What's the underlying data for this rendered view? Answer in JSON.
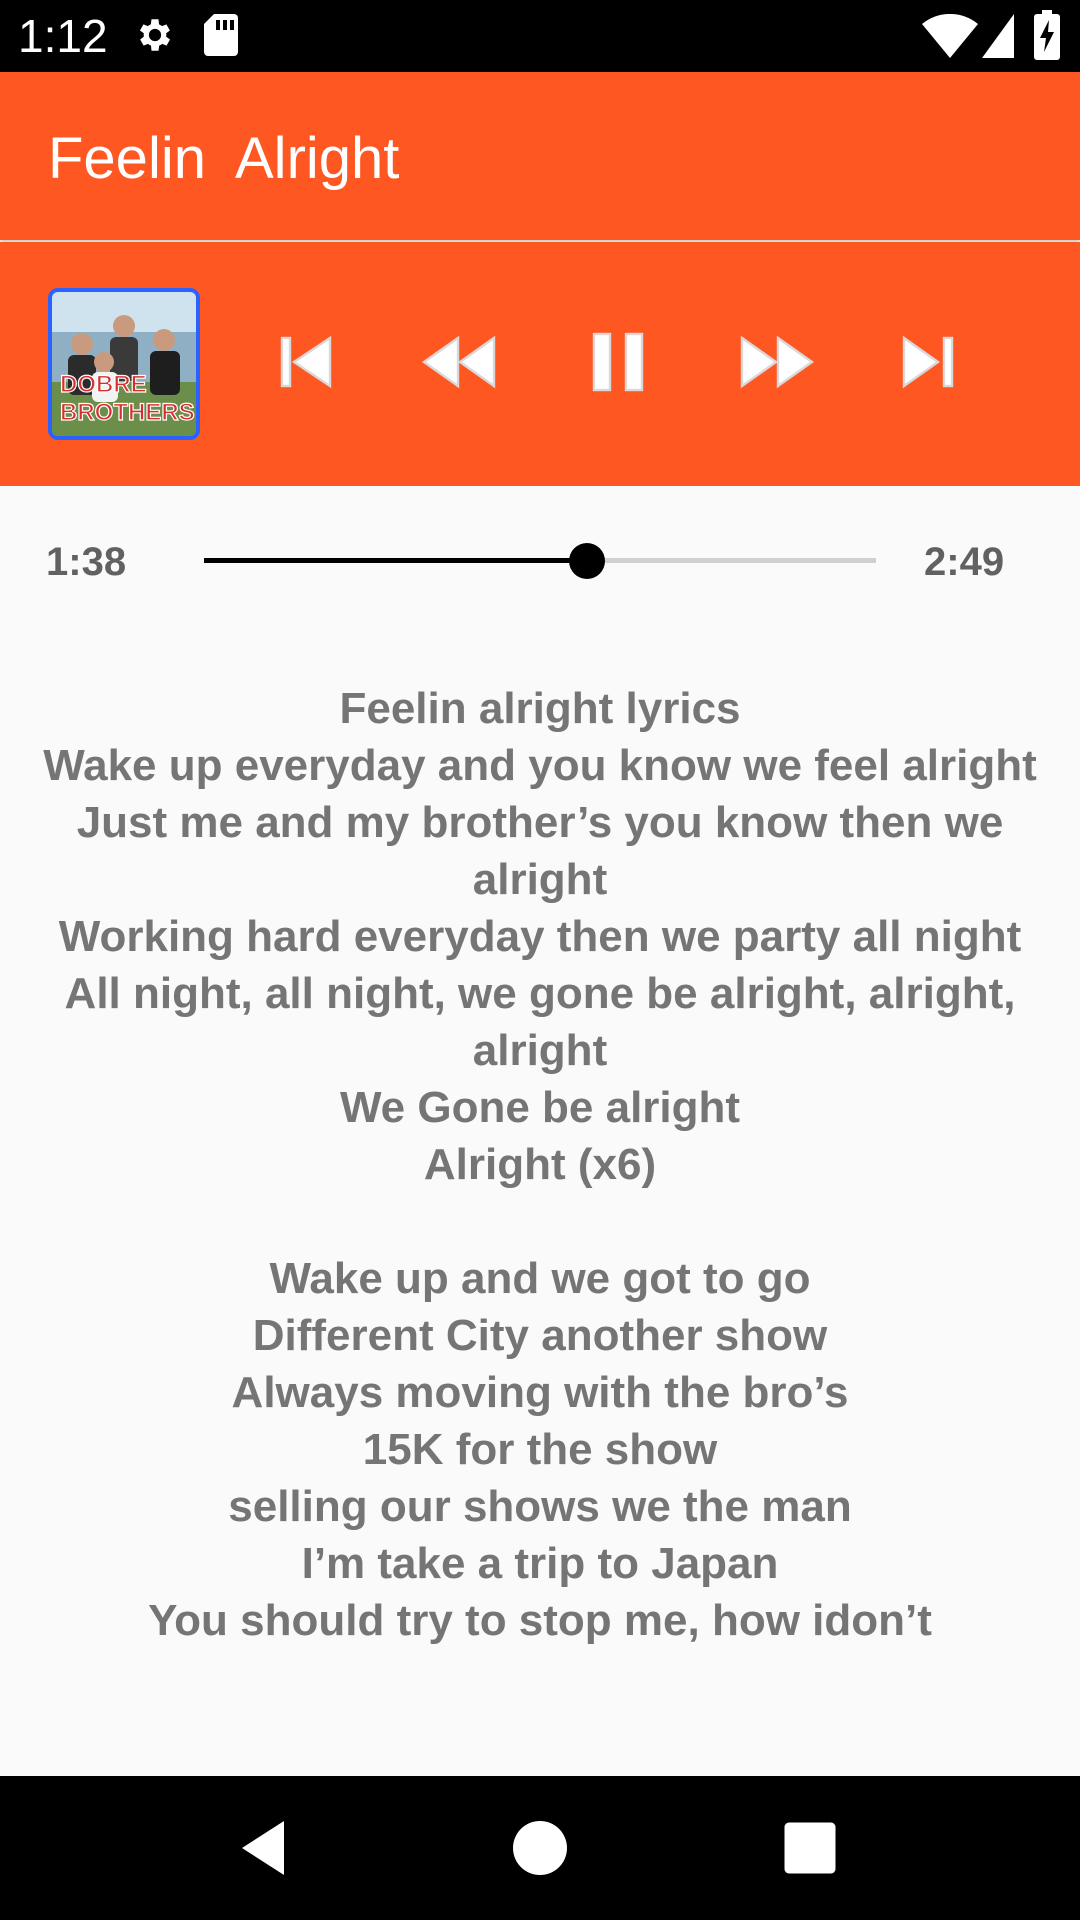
{
  "status_bar": {
    "time": "1:12",
    "icons": [
      "gear-icon",
      "sd-card-icon",
      "wifi-icon",
      "cell-signal-icon",
      "battery-charging-icon"
    ]
  },
  "app_bar": {
    "title": "Feelin  Alright",
    "color": "#ff5722"
  },
  "player": {
    "album_art": {
      "icon": "album-art",
      "label_line1": "DOBRE",
      "label_line2": "BROTHERS"
    },
    "controls": [
      "skip-previous-icon",
      "rewind-icon",
      "pause-icon",
      "fast-forward-icon",
      "skip-next-icon"
    ]
  },
  "seek": {
    "elapsed": "1:38",
    "total": "2:49",
    "progress": 0.57
  },
  "lyrics": [
    "Feelin alright lyrics",
    "Wake up everyday and you know we feel alright",
    "Just me and my brother’s you know then we alright",
    "Working hard everyday then we party all night",
    "All night, all night, we gone be alright, alright, alright",
    "We Gone be alright",
    "Alright (x6)",
    "",
    "Wake up and we got to go",
    "Different City another show",
    "Always moving with the bro’s",
    "15K for the show",
    "selling our shows we the man",
    "I’m take a trip to Japan",
    "You should try to stop me, how idon’t"
  ],
  "nav_bar": {
    "buttons": [
      "back-icon",
      "home-icon",
      "recents-icon"
    ]
  }
}
